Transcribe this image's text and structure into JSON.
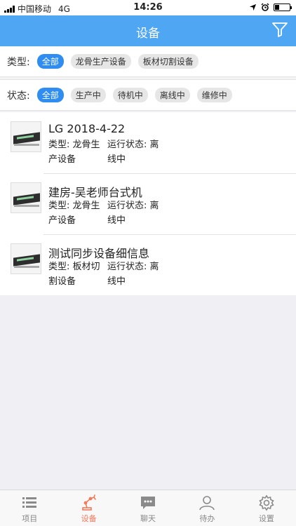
{
  "statusbar": {
    "carrier": "中国移动",
    "network": "4G",
    "time": "14:26",
    "battery_level": 0.3
  },
  "header": {
    "title": "设备"
  },
  "filters": {
    "type": {
      "label": "类型:",
      "options": [
        "全部",
        "龙骨生产设备",
        "板材切割设备"
      ],
      "selected": "全部"
    },
    "status": {
      "label": "状态:",
      "options": [
        "全部",
        "生产中",
        "待机中",
        "离线中",
        "维修中"
      ],
      "selected": "全部"
    }
  },
  "devices": [
    {
      "name": "LG 2018-4-22",
      "type_lines": [
        "类型: 龙骨生",
        "产设备"
      ],
      "status_lines": [
        "运行状态: 离",
        "线中"
      ]
    },
    {
      "name": "建房-吴老师台式机",
      "type_lines": [
        "类型: 龙骨生",
        "产设备"
      ],
      "status_lines": [
        "运行状态: 离",
        "线中"
      ]
    },
    {
      "name": "测试同步设备细信息",
      "type_lines": [
        "类型: 板材切",
        "割设备"
      ],
      "status_lines": [
        "运行状态: 离",
        "线中"
      ]
    }
  ],
  "tabs": [
    {
      "label": "项目",
      "icon": "list-icon"
    },
    {
      "label": "设备",
      "icon": "robot-arm-icon",
      "active": true
    },
    {
      "label": "聊天",
      "icon": "chat-icon"
    },
    {
      "label": "待办",
      "icon": "person-icon"
    },
    {
      "label": "设置",
      "icon": "gear-icon"
    }
  ],
  "colors": {
    "header": "#4fa6f2",
    "chip_active": "#2f8cf0",
    "tab_active": "#f07a5a"
  }
}
